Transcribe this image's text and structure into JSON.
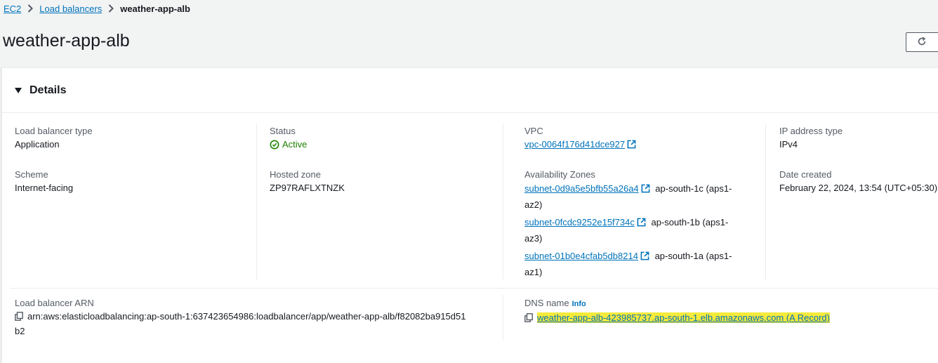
{
  "breadcrumb": {
    "items": [
      "EC2",
      "Load balancers"
    ],
    "current": "weather-app-alb"
  },
  "page": {
    "title": "weather-app-alb"
  },
  "details": {
    "section_title": "Details",
    "load_balancer_type": {
      "label": "Load balancer type",
      "value": "Application"
    },
    "scheme": {
      "label": "Scheme",
      "value": "Internet-facing"
    },
    "status": {
      "label": "Status",
      "value": "Active"
    },
    "hosted_zone": {
      "label": "Hosted zone",
      "value": "ZP97RAFLXTNZK"
    },
    "vpc": {
      "label": "VPC",
      "value": "vpc-0064f176d41dce927"
    },
    "availability_zones": {
      "label": "Availability Zones",
      "subnets": [
        {
          "id": "subnet-0d9a5e5bfb55a26a4",
          "zone": "ap-south-1c (aps1-",
          "zone_cont": "az2)"
        },
        {
          "id": "subnet-0fcdc9252e15f734c",
          "zone": "ap-south-1b (aps1-",
          "zone_cont": "az3)"
        },
        {
          "id": "subnet-01b0e4cfab5db8214",
          "zone": "ap-south-1a (aps1-",
          "zone_cont": "az1)"
        }
      ]
    },
    "ip_address_type": {
      "label": "IP address type",
      "value": "IPv4"
    },
    "date_created": {
      "label": "Date created",
      "value": "February 22, 2024, 13:54 (UTC+05:30)"
    },
    "arn": {
      "label": "Load balancer ARN",
      "value_line1": "arn:aws:elasticloadbalancing:ap-south-1:637423654986:loadbalancer/app/weather-app-alb/f82082ba915d51",
      "value_line2": "b2"
    },
    "dns": {
      "label": "DNS name",
      "info_label": "Info",
      "value": "weather-app-alb-423985737.ap-south-1.elb.amazonaws.com (A Record)"
    }
  },
  "colors": {
    "link": "#0073bb",
    "success": "#1d8102",
    "highlight": "#f6ea3b"
  }
}
